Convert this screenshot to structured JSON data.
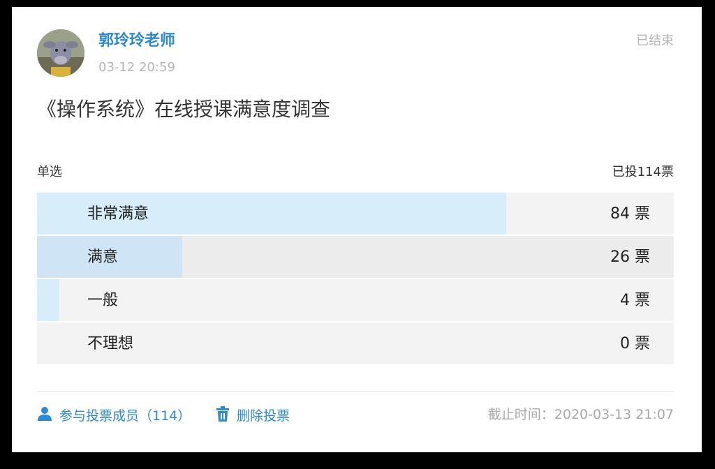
{
  "post": {
    "author": "郭玲玲老师",
    "time": "03-12 20:59",
    "status": "已结束",
    "title": "《操作系统》在线授课满意度调查"
  },
  "vote": {
    "type": "单选",
    "total_label": "已投114票",
    "total": 114,
    "options": [
      {
        "label": "非常满意",
        "count_label": "84 票",
        "count": 84
      },
      {
        "label": "满意",
        "count_label": "26 票",
        "count": 26
      },
      {
        "label": "一般",
        "count_label": "4 票",
        "count": 4
      },
      {
        "label": "不理想",
        "count_label": "0 票",
        "count": 0
      }
    ]
  },
  "footer": {
    "members_label": "参与投票成员（114）",
    "delete_label": "删除投票",
    "deadline": "截止时间：2020-03-13 21:07"
  },
  "colors": {
    "accent": "#2b8ad6",
    "bar_fill": "#d8edfa",
    "muted_text": "#b5b5b5"
  },
  "icons": [
    "avatar-image",
    "user-icon",
    "trash-icon"
  ]
}
